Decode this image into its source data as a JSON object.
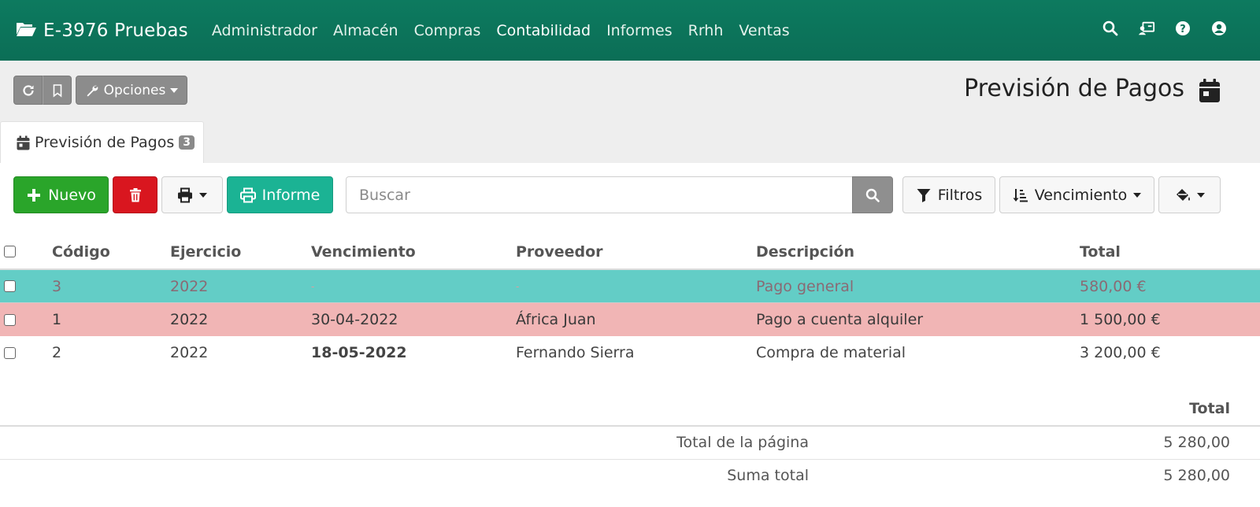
{
  "navbar": {
    "brand": "E-3976 Pruebas",
    "menu": [
      {
        "label": "Administrador"
      },
      {
        "label": "Almacén"
      },
      {
        "label": "Compras"
      },
      {
        "label": "Contabilidad",
        "active": true
      },
      {
        "label": "Informes"
      },
      {
        "label": "Rrhh"
      },
      {
        "label": "Ventas"
      }
    ],
    "icons": [
      "search-icon",
      "contact-card-icon",
      "help-icon",
      "user-icon"
    ],
    "color": "#0d7a5f"
  },
  "header": {
    "options_label": "Opciones",
    "page_title": "Previsión de Pagos"
  },
  "tab": {
    "label": "Previsión de Pagos",
    "count": "3"
  },
  "toolbar": {
    "new_label": "Nuevo",
    "report_label": "Informe",
    "search_placeholder": "Buscar",
    "filters_label": "Filtros",
    "order_label": "Vencimiento"
  },
  "table": {
    "columns": [
      "Código",
      "Ejercicio",
      "Vencimiento",
      "Proveedor",
      "Descripción",
      "Total"
    ],
    "rows": [
      {
        "codigo": "3",
        "ejercicio": "2022",
        "vencimiento": "-",
        "proveedor": "-",
        "descripcion": "Pago general",
        "total": "580,00 €",
        "status_color": "#63cdc6"
      },
      {
        "codigo": "1",
        "ejercicio": "2022",
        "vencimiento": "30-04-2022",
        "proveedor": "África Juan",
        "descripcion": "Pago a cuenta alquiler",
        "total": "1 500,00 €",
        "status_color": "#f1b5b5"
      },
      {
        "codigo": "2",
        "ejercicio": "2022",
        "vencimiento": "18-05-2022",
        "proveedor": "Fernando Sierra",
        "descripcion": "Compra de material",
        "total": "3 200,00 €",
        "status_color": "#ffffff"
      }
    ]
  },
  "totals": {
    "header": "Total",
    "page_label": "Total de la página",
    "page_value": "5 280,00",
    "sum_label": "Suma total",
    "sum_value": "5 280,00"
  }
}
